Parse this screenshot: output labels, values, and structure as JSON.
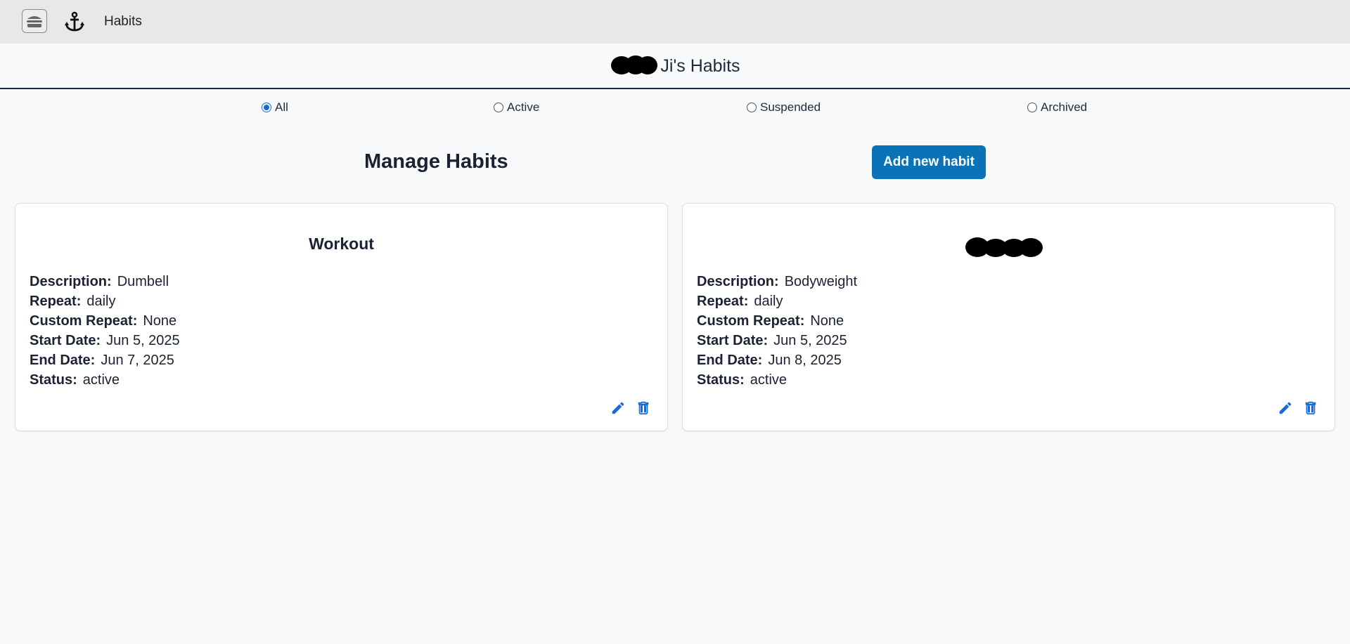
{
  "app": {
    "nav_label": "Habits",
    "menu_icon": "hamburger-icon",
    "logo_icon": "anchor-icon"
  },
  "header": {
    "title_suffix": "Ji's Habits"
  },
  "filters": [
    {
      "label": "All",
      "checked": true
    },
    {
      "label": "Active",
      "checked": false
    },
    {
      "label": "Suspended",
      "checked": false
    },
    {
      "label": "Archived",
      "checked": false
    }
  ],
  "main": {
    "title": "Manage Habits",
    "add_button": "Add new habit"
  },
  "labels": {
    "description": "Description:",
    "repeat": "Repeat:",
    "custom_repeat": "Custom Repeat:",
    "start_date": "Start Date:",
    "end_date": "End Date:",
    "status": "Status:"
  },
  "habits": [
    {
      "title": "Workout",
      "description": "Dumbell",
      "repeat": "daily",
      "custom_repeat": "None",
      "start_date": "Jun 5, 2025",
      "end_date": "Jun 7, 2025",
      "status": "active"
    },
    {
      "title": "",
      "description": "Bodyweight",
      "repeat": "daily",
      "custom_repeat": "None",
      "start_date": "Jun 5, 2025",
      "end_date": "Jun 8, 2025",
      "status": "active"
    }
  ],
  "colors": {
    "accent": "#0a73b8",
    "icon_blue": "#1669d9",
    "topbar": "#e8e8e8"
  }
}
